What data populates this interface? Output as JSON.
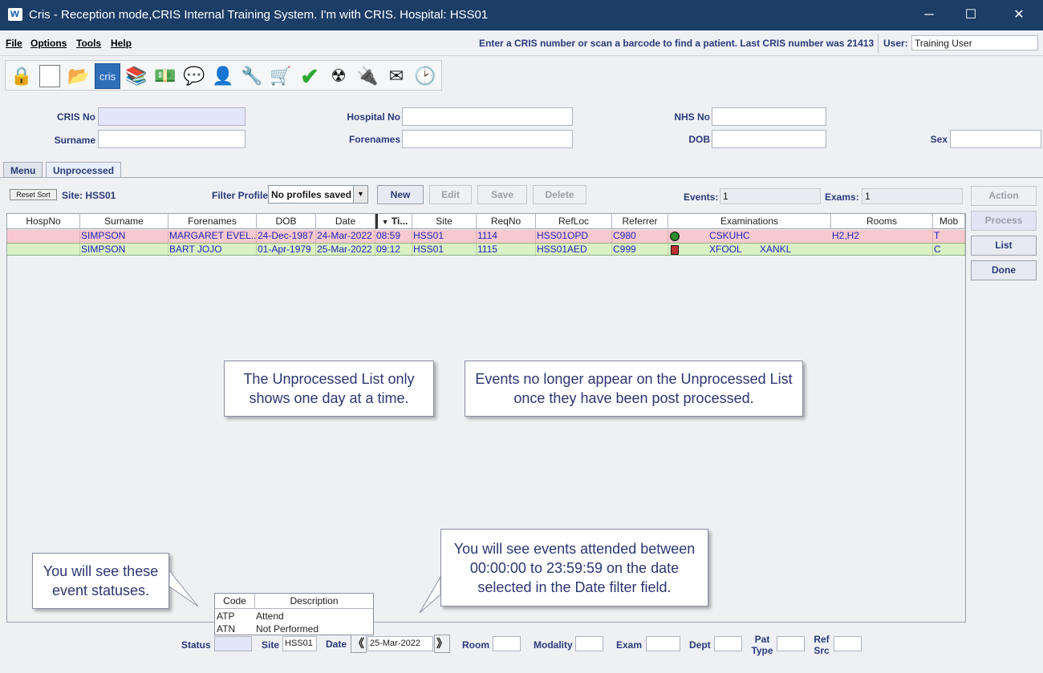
{
  "window": {
    "title": "Cris - Reception mode,CRIS Internal Training System. I'm with CRIS.   Hospital: HSS01",
    "minimize": "─",
    "maximize": "☐",
    "close": "✕"
  },
  "menu": {
    "items": [
      {
        "label": "File"
      },
      {
        "label": "Options"
      },
      {
        "label": "Tools"
      },
      {
        "label": "Help"
      }
    ],
    "hint": "Enter a CRIS number or scan a barcode to find a patient. Last CRIS number was 21413",
    "user_label": "User:",
    "user_value": "Training User"
  },
  "toolbar": {
    "icons": [
      "lock-icon",
      "blank-page-icon",
      "folder-icon",
      "cris-icon",
      "books-icon",
      "money-icon",
      "chat-icon",
      "person-info-icon",
      "wrench-icon",
      "cart-icon",
      "check-icon",
      "radiation-icon",
      "plug-icon",
      "envelope-icon",
      "clock-icon"
    ],
    "cris_label": "cris"
  },
  "search": {
    "cris_no": "CRIS No",
    "surname": "Surname",
    "hospital_no": "Hospital No",
    "forenames": "Forenames",
    "nhs_no": "NHS No",
    "dob": "DOB",
    "sex": "Sex"
  },
  "tabs": [
    {
      "label": "Menu"
    },
    {
      "label": "Unprocessed"
    }
  ],
  "filters": {
    "reset_sort": "Reset Sort",
    "site_label": "Site: HSS01",
    "filter_profile_label": "Filter Profile",
    "filter_profile_value": "No profiles saved",
    "new": "New",
    "edit": "Edit",
    "save": "Save",
    "delete": "Delete",
    "events_label": "Events:",
    "events_value": "1",
    "exams_label": "Exams:",
    "exams_value": "1"
  },
  "grid": {
    "headers": [
      "HospNo",
      "Surname",
      "Forenames",
      "DOB",
      "Date",
      "Ti...",
      "Site",
      "ReqNo",
      "RefLoc",
      "Referrer",
      "Examinations",
      "Rooms",
      "Mob"
    ],
    "sort_indicator": "▼",
    "rows": [
      {
        "hospno": "",
        "surname": "SIMPSON",
        "forenames": "MARGARET EVEL...",
        "dob": "24-Dec-1987",
        "date": "24-Mar-2022",
        "time": "08:59",
        "site": "HSS01",
        "reqno": "1114",
        "refloc": "HSS01OPD",
        "referrer": "C980",
        "exam1": "CSKUHC",
        "exam2": "",
        "rooms": "H2,H2",
        "mob": "T"
      },
      {
        "hospno": "",
        "surname": "SIMPSON",
        "forenames": "BART JOJO",
        "dob": "01-Apr-1979",
        "date": "25-Mar-2022",
        "time": "09:12",
        "site": "HSS01",
        "reqno": "1115",
        "refloc": "HSS01AED",
        "referrer": "C999",
        "exam1": "XFOOL",
        "exam2": "XANKL",
        "rooms": "",
        "mob": "C"
      }
    ]
  },
  "side_buttons": {
    "action": "Action",
    "process": "Process",
    "list": "List",
    "done": "Done"
  },
  "callouts": {
    "one_day": "The Unprocessed List only shows one day at a time.",
    "post_processed": "Events no longer appear on the Unprocessed List once they have been post processed.",
    "statuses": "You will see these event statuses.",
    "attended": "You will see events attended between 00:00:00 to 23:59:59 on the date selected in the Date filter field."
  },
  "status_popup": {
    "headers": [
      "Code",
      "Description"
    ],
    "rows": [
      {
        "code": "ATP",
        "description": "Attend"
      },
      {
        "code": "ATN",
        "description": "Not Performed"
      }
    ]
  },
  "bottom_filters": {
    "status": "Status",
    "site": "Site",
    "site_value": "HSS01",
    "date": "Date",
    "date_value": "25-Mar-2022",
    "prev": "《",
    "next": "》",
    "room": "Room",
    "modality": "Modality",
    "exam": "Exam",
    "dept": "Dept",
    "pat_type": "Pat Type",
    "ref_src": "Ref Src"
  }
}
